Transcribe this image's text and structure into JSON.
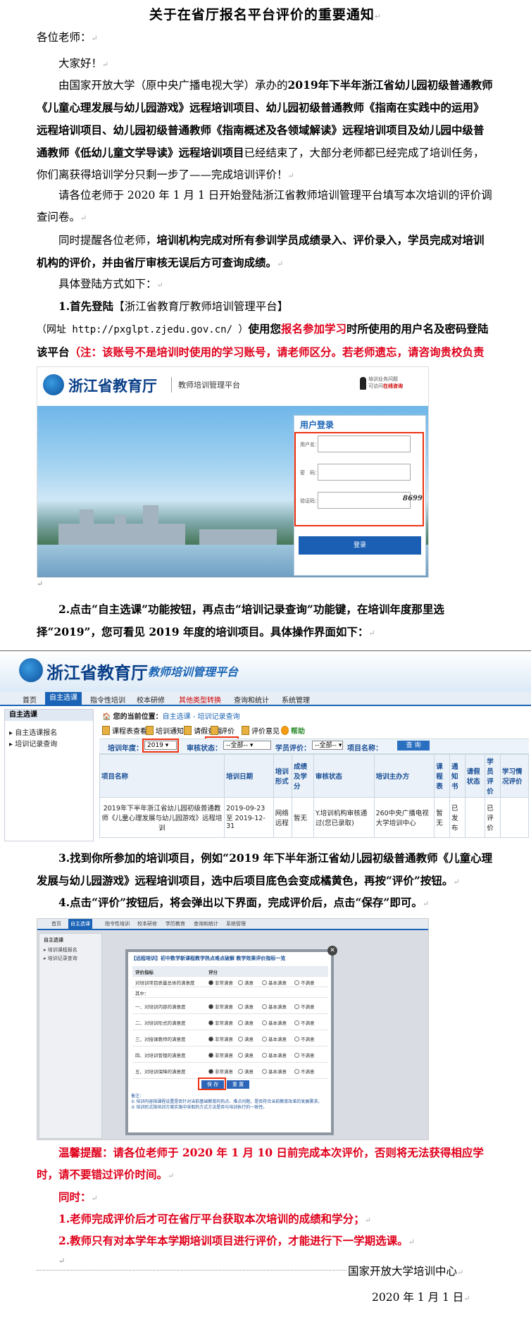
{
  "doc": {
    "title": "关于在省厅报名平台评价的重要通知",
    "greeting": "各位老师：",
    "hello": "大家好！",
    "intro_a": "由国家开放大学（原中央广播电视大学）承办的",
    "intro_b": "2019年下半年浙江省幼儿园初级普通教师《儿童心理发展与幼儿园游戏》远程培训项目、幼儿园初级普通教师《指南在实践中的运用》远程培训项目、幼儿园初级普通教师《指南概述及各领域解读》远程培训项目及幼儿园中级普通教师《低幼儿童文学导读》远程培训项目",
    "intro_c": "已经结束了，大部分老师都已经完成了培训任务，你们离获得培训学分只剩一步了——完成培训评价！",
    "start_line": "请各位老师于 2020 年 1 月 1 日开始登陆浙江省教师培训管理平台填写本次培训的评价调查问卷。",
    "remind_a": "同时提醒各位老师，",
    "remind_b": "培训机构完成对所有参训学员成绩录入、评价录入，学员完成对培训机构的评价，并由省厅审核无误后方可查询成绩。",
    "method": "具体登陆方式如下：",
    "step1_a": "1.首先登陆",
    "step1_b": "【浙江省教育厅教师培训管理平台】",
    "step1_c": "（网址 http://pxglpt.zjedu.gov.cn/ ）",
    "step1_d": "使用您",
    "step1_e": "报名参加学习",
    "step1_f": "时所使用的用户名及密码登陆该平台",
    "step1_g": "（注：该账号不是培训时使用的学习账号，请老师区分。若老师遗忘，请咨询贵校负责继续教育管理老师）",
    "step2": "2.点击“自主选课”功能按钮，再点击“培训记录查询”功能键，在培训年度那里选择“2019”，您可看见 2019 年度的培训项目。具体操作界面如下：",
    "step3": "3.找到你所参加的培训项目，例如“2019 年下半年浙江省幼儿园初级普通教师《儿童心理发展与幼儿园游戏》远程培训项目，选中后项目底色会变成橘黄色，再按“评价”按钮。",
    "step4": "4.点击“评价”按钮后，将会弹出以下界面，完成评价后，点击“保存”即可。",
    "warm": "温馨提醒：请各位老师于 2020 年 1 月 10 日前完成本次评价，否则将无法获得相应学时，请不要错过评价时间。",
    "also": "同时：",
    "also1": "1.老师完成评价后才可在省厅平台获取本次培训的成绩和学分；",
    "also2": "2.教师只有对本学年本学期培训项目进行评价，才能进行下一学期选课。",
    "org": "国家开放大学培训中心",
    "date": "2020 年 1 月 1 日"
  },
  "login": {
    "brand": "浙江省教育厅",
    "platform": "教师培训管理平台",
    "help1": "培训业务问题",
    "help2": "可访问",
    "help3": "在线咨询",
    "box_title": "用户登录",
    "user_label": "用户名：",
    "pass_label": "密　码：",
    "code_label": "验证码：",
    "captcha": "8699",
    "login_btn": "登录"
  },
  "record": {
    "brand": "浙江省教育厅",
    "platform": "教师培训管理平台",
    "nav": [
      "首页",
      "自主选课",
      "指令性培训",
      "校本研修",
      "其他类型转换",
      "查询和统计",
      "系统管理"
    ],
    "side_title": "自主选课",
    "side_items": [
      "自主选课报名",
      "培训记录查询"
    ],
    "crumb_a": "您的当前位置：",
    "crumb_b": "自主选课 - 培训记录查询",
    "tools": [
      "课程表查看",
      "培训通知书",
      "请假查看",
      "评价",
      "评价意见",
      "帮助"
    ],
    "f_year": "培训年度：",
    "f_year_val": "2019",
    "f_audit": "审核状态：",
    "f_audit_val": "--全部--",
    "f_eval": "学员评价：",
    "f_eval_val": "--全部--",
    "f_name": "项目名称：",
    "query": "查 询",
    "cols": [
      "项目名称",
      "培训日期",
      "培训形式",
      "成绩及学分",
      "审核状态",
      "培训主办方",
      "课程表",
      "通知书",
      "请假状态",
      "学员评价",
      "学习情况评价"
    ],
    "row": {
      "name": "2019年下半年浙江省幼儿园初级普通教师《儿童心理发展与幼儿园游戏》远程培训",
      "date": "2019-09-23 至 2019-12-31",
      "form": "网络远程",
      "score": "暂无",
      "audit": "Y.培训机构审核通过(您已录取)",
      "host": "260中央广播电视大学培训中心",
      "sched": "暂无",
      "notice": "已发布",
      "leave": "",
      "eval": "已评价",
      "study": ""
    }
  },
  "dialog": {
    "nav": [
      "首页",
      "自主选课",
      "指令性培训",
      "校本研修",
      "学历教育",
      "查询和统计",
      "系统管理"
    ],
    "side_title": "自主选课",
    "side_items": [
      "培训课程报名",
      "培训记录查询"
    ],
    "title": "【远程培训】初中数学新课程教学热点难点破解 教学效果评价指标一览",
    "head_a": "评价指标",
    "head_b": "评分",
    "overall": "对培训项目质量总体的满意度",
    "sub": "其中：",
    "items": [
      "一、对培训内容的满意度",
      "二、对培训形式的满意度",
      "三、对授课教师的满意度",
      "四、对培训管理的满意度",
      "五、对培训保障的满意度"
    ],
    "options": [
      "非常满意",
      "满意",
      "基本满意",
      "不满意"
    ],
    "save": "保 存",
    "reset": "重 置",
    "note1": "备注：",
    "note2": "① 培训内容指课程设置是否针对当前基础教育的热点、难点问题，是否符合当前教育改革的发展需求。",
    "note3": "② 培训形式指培训方案实施中采取的方式方法是否与培训执行的一致性。"
  }
}
